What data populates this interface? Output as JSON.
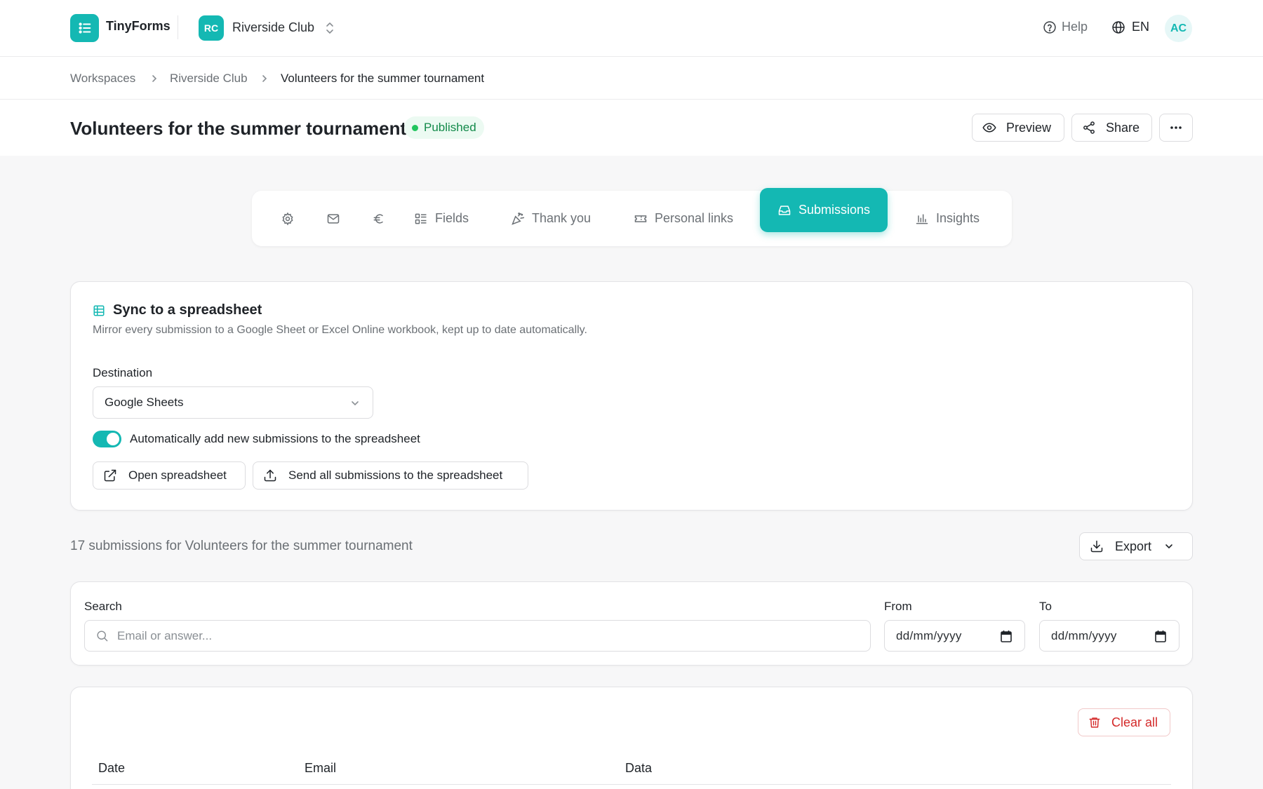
{
  "app": {
    "name": "TinyForms"
  },
  "workspace": {
    "initials": "RC",
    "name": "Riverside Club"
  },
  "topnav": {
    "help": "Help",
    "language": "EN",
    "user_initials": "AC"
  },
  "breadcrumb": [
    "Workspaces",
    "Riverside Club",
    "Volunteers for the summer tournament"
  ],
  "form": {
    "title": "Volunteers for the summer tournament",
    "status": "Published",
    "actions": {
      "preview": "Preview",
      "share": "Share"
    }
  },
  "tabs": [
    {
      "icon": "gear-icon",
      "label": ""
    },
    {
      "icon": "mail-icon",
      "label": ""
    },
    {
      "icon": "euro-icon",
      "label": ""
    },
    {
      "icon": "fields-icon",
      "label": "Fields"
    },
    {
      "icon": "party-popper-icon",
      "label": "Thank you"
    },
    {
      "icon": "ticket-icon",
      "label": "Personal links"
    },
    {
      "icon": "inbox-icon",
      "label": "Submissions",
      "active": true
    },
    {
      "icon": "bar-chart-icon",
      "label": "Insights"
    }
  ],
  "sync": {
    "title": "Sync to a spreadsheet",
    "description": "Mirror every submission to a Google Sheet or Excel Online workbook, kept up to date automatically.",
    "destination_label": "Destination",
    "destination_value": "Google Sheets",
    "auto_add_label": "Automatically add new submissions to the spreadsheet",
    "auto_add_enabled": true,
    "open_button": "Open spreadsheet",
    "send_all_button": "Send all submissions to the spreadsheet"
  },
  "submissions": {
    "summary": "17 submissions for Volunteers for the summer tournament",
    "export": "Export",
    "filters": {
      "search_label": "Search",
      "search_placeholder": "Email or answer...",
      "from_label": "From",
      "to_label": "To",
      "date_placeholder": "dd/mm/yyyy"
    },
    "clear_all": "Clear all",
    "columns": [
      "Date",
      "Email",
      "Data"
    ]
  },
  "colors": {
    "accent": "#14b8b3",
    "success": "#22c55e",
    "danger": "#d42a2a"
  }
}
